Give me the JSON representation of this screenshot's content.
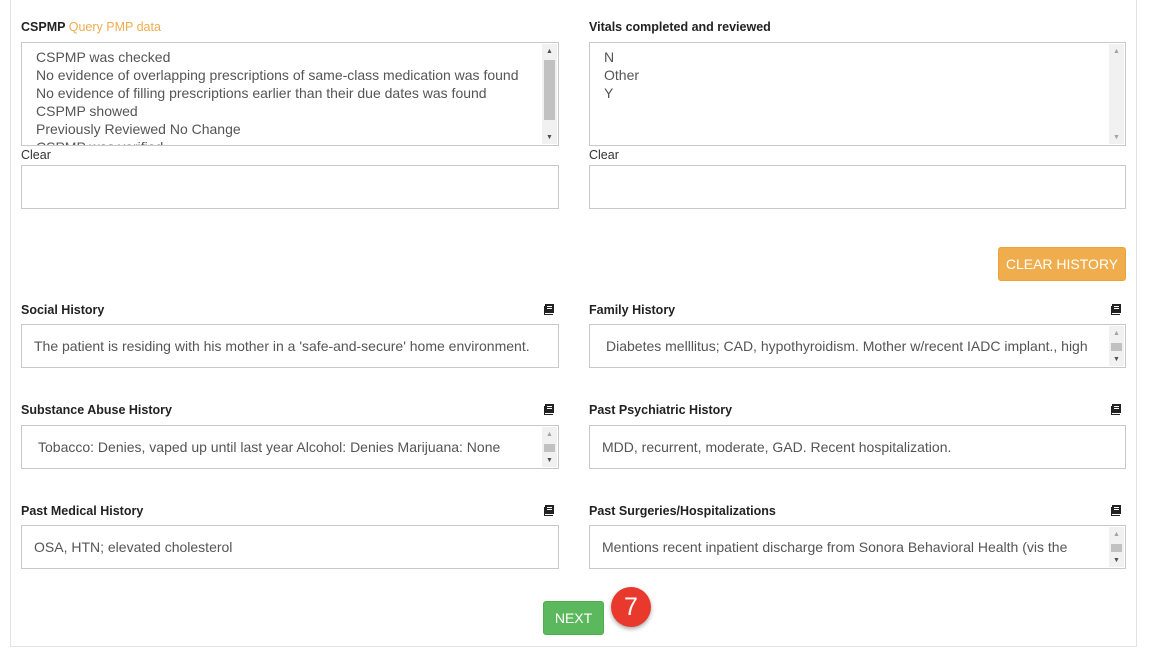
{
  "cspmp": {
    "label": "CSPMP",
    "link": "Query PMP data",
    "options": [
      "CSPMP was checked",
      "No evidence of overlapping prescriptions of same-class medication was found",
      "No evidence of filling prescriptions earlier than their due dates was found",
      "CSPMP showed",
      "Previously Reviewed No Change",
      "CSPMP was verified"
    ],
    "clear_label": "Clear",
    "text_value": ""
  },
  "vitals": {
    "label": "Vitals completed and reviewed",
    "options": [
      "N",
      "Other",
      "Y"
    ],
    "clear_label": "Clear",
    "text_value": ""
  },
  "clear_history_button": "CLEAR HISTORY",
  "history": {
    "social": {
      "label": "Social History",
      "value": "The patient is residing with his mother in a 'safe-and-secure' home environment.",
      "icon": "book-icon"
    },
    "family": {
      "label": "Family History",
      "value": "Diabetes melllitus; CAD, hypothyroidism. Mother w/recent IADC implant., high",
      "icon": "book-icon"
    },
    "substance": {
      "label": "Substance Abuse History",
      "value": "Tobacco: Denies, vaped up until last year Alcohol: Denies Marijuana: None",
      "icon": "book-icon"
    },
    "psychiatric": {
      "label": "Past Psychiatric History",
      "value": "MDD, recurrent, moderate, GAD. Recent hospitalization.",
      "icon": "book-icon"
    },
    "medical": {
      "label": "Past Medical History",
      "value": "OSA, HTN; elevated cholesterol",
      "icon": "book-icon"
    },
    "surgeries": {
      "label": "Past Surgeries/Hospitalizations",
      "value": "Mentions recent inpatient discharge from Sonora Behavioral Health (vis the",
      "icon": "book-icon"
    }
  },
  "next_button": "NEXT",
  "step_badge": "7",
  "colors": {
    "warning": "#f0ad4e",
    "success": "#5cb85c",
    "badge": "#e8392c"
  }
}
